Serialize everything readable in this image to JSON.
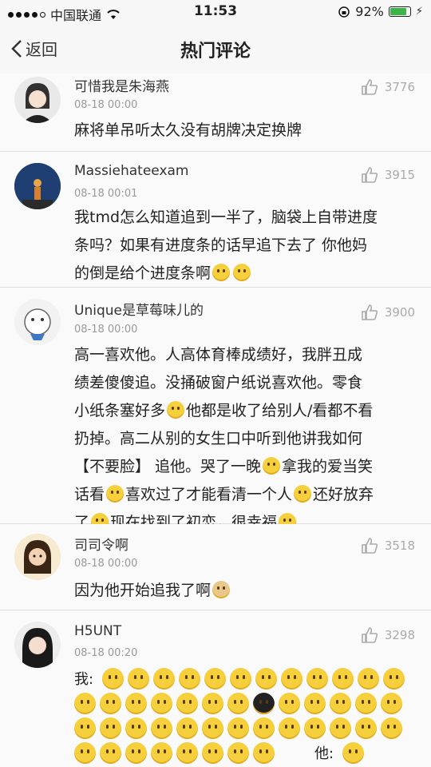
{
  "status_bar": {
    "carrier": "中国联通",
    "time": "11:53",
    "battery_percent": "92%",
    "battery_level": 0.92
  },
  "nav": {
    "back_label": "返回",
    "title": "热门评论"
  },
  "comments": [
    {
      "user": "可惜我是朱海燕",
      "date": "08-18 00:00",
      "likes": "3776",
      "text": "麻将单吊听太久没有胡牌决定换牌"
    },
    {
      "user": "Massiehateexam",
      "date": "08-18 00:01",
      "likes": "3915",
      "text_lines": [
        "我tmd怎么知道追到一半了，脑袋上自带进度",
        "条吗？如果有进度条的话早追下去了 你他妈",
        "的倒是给个进度条啊"
      ]
    },
    {
      "user": "Unique是草莓味儿的",
      "date": "08-18 00:00",
      "likes": "3900",
      "text_lines": [
        "高一喜欢他。人高体育棒成绩好，我胖丑成",
        "绩差傻傻追。没捅破窗户纸说喜欢他。零食",
        "小纸条塞好多",
        "他都是收了给别人/看都不看",
        "扔掉。高二从别的女生口中听到他讲我如何",
        "【不要脸】 追他。哭了一晚",
        "拿我的爱当笑",
        "话看",
        "喜欢过了才能看清一个人",
        "还好放弃",
        "了",
        "现在找到了初恋，很幸福"
      ]
    },
    {
      "user": "司司令啊",
      "date": "08-18 00:00",
      "likes": "3518",
      "text": "因为他开始追我了啊"
    },
    {
      "user": "H5UNT",
      "date": "08-18 00:20",
      "likes": "3298",
      "me_label": "我:",
      "him_label": "他:"
    }
  ]
}
